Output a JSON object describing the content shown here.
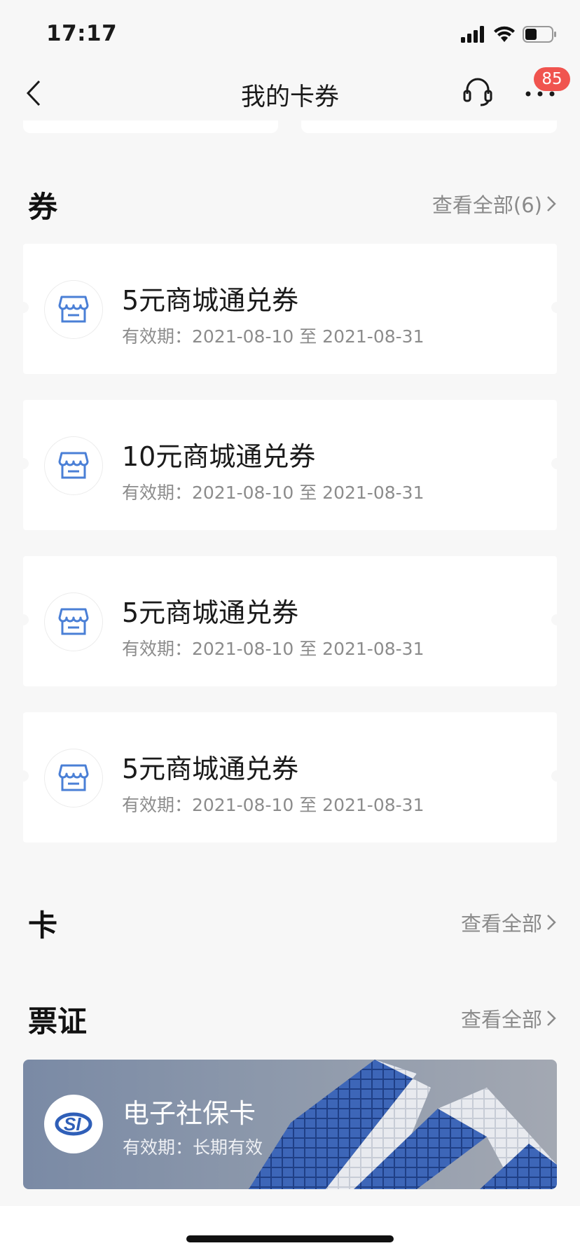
{
  "status_bar": {
    "time": "17:17"
  },
  "nav": {
    "title": "我的卡券",
    "badge_count": "85"
  },
  "sections": {
    "coupons": {
      "title": "券",
      "view_all": "查看全部(6)"
    },
    "cards": {
      "title": "卡",
      "view_all": "查看全部"
    },
    "tickets": {
      "title": "票证",
      "view_all": "查看全部"
    }
  },
  "coupons": [
    {
      "title": "5元商城通兑券",
      "validity": "有效期：2021-08-10 至 2021-08-31"
    },
    {
      "title": "10元商城通兑券",
      "validity": "有效期：2021-08-10 至 2021-08-31"
    },
    {
      "title": "5元商城通兑券",
      "validity": "有效期：2021-08-10 至 2021-08-31"
    },
    {
      "title": "5元商城通兑券",
      "validity": "有效期：2021-08-10 至 2021-08-31"
    }
  ],
  "social_security_card": {
    "title": "电子社保卡",
    "validity": "有效期：长期有效",
    "logo_text": "SI"
  },
  "icons": {
    "back": "chevron-left-icon",
    "support": "headset-icon",
    "more": "ellipsis-icon",
    "coupon": "store-icon",
    "view_all": "chevron-right-icon"
  },
  "colors": {
    "accent_blue": "#4a7fd6",
    "badge_red": "#f0544f",
    "background": "#f7f7f7"
  }
}
